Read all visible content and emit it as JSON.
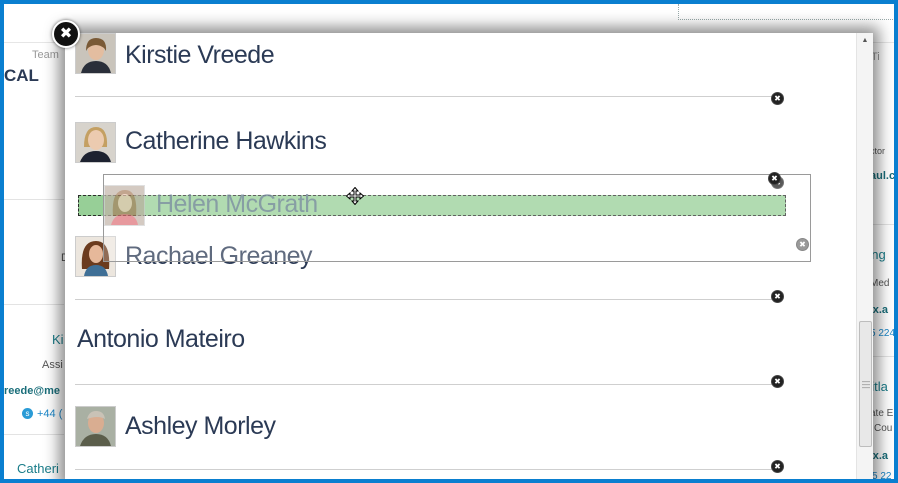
{
  "background": {
    "team_label": "Team",
    "heading_fragment": "CAL",
    "right_label_fragment": "g Ti",
    "right_role_fragment": "ctor",
    "right_email_fragment": "aul.c",
    "right_name_fragment_1": "ring",
    "right_role_fragment_2": "Med",
    "right_email_fragment_2": "ox.a",
    "right_phone_fragment": "5 224",
    "right_name_fragment_3": "aitla",
    "right_role_fragment_3": "ate E",
    "right_role_fragment_4": "Cou",
    "right_email_fragment_3": "ox.a",
    "right_phone_fragment_2": "5 22",
    "left_d_fragment": "D",
    "left_name_fragment": "Ki",
    "left_role_fragment": "Assi",
    "left_email_fragment": "reede@me",
    "left_phone_fragment": "+44 (",
    "left_name_fragment_2": "Catheri"
  },
  "modal": {
    "close_label": "✖",
    "items": [
      {
        "name": "Kirstie Vreede",
        "has_avatar": true
      },
      {
        "name": "Catherine Hawkins",
        "has_avatar": true
      },
      {
        "name": "Rachael Greaney",
        "has_avatar": true
      },
      {
        "name": "Antonio Mateiro",
        "has_avatar": false
      },
      {
        "name": "Ashley Morley",
        "has_avatar": true
      }
    ],
    "dragging": {
      "name": "Helen McGrath"
    },
    "remove_glyph": "✖"
  },
  "colors": {
    "frame": "#0a7fd0",
    "placeholder": "#97cf97",
    "name_text": "#2b3a55"
  }
}
